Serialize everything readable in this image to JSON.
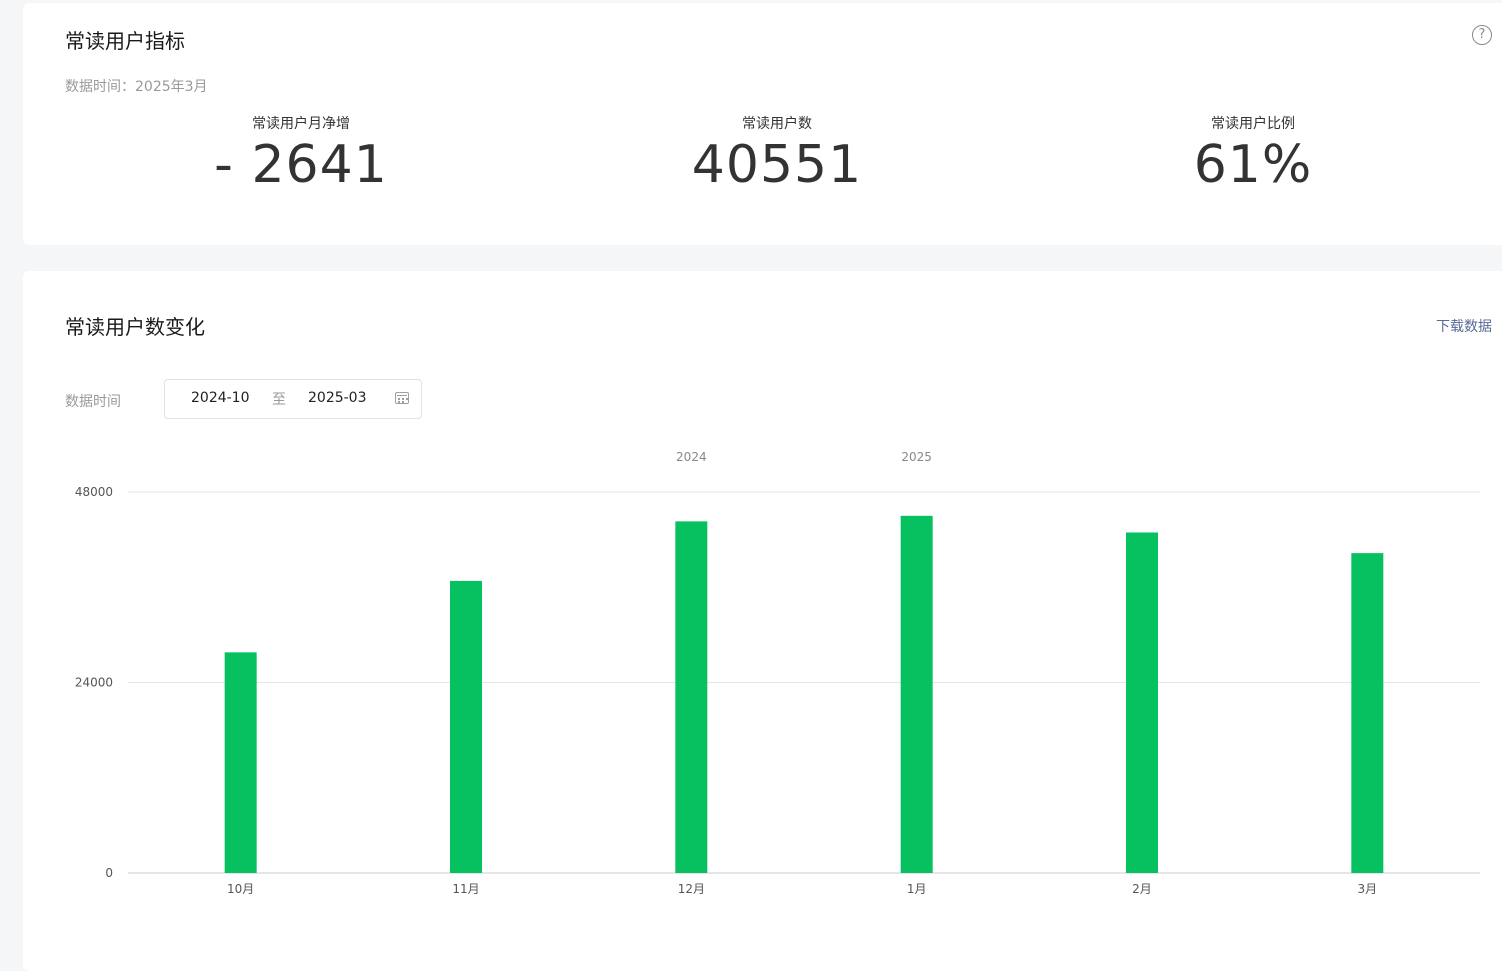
{
  "metrics_card": {
    "title": "常读用户指标",
    "help_icon": "question-circle-icon",
    "data_time": "数据时间：2025年3月",
    "metrics": [
      {
        "label": "常读用户月净增",
        "value": "- 2641"
      },
      {
        "label": "常读用户数",
        "value": "40551"
      },
      {
        "label": "常读用户比例",
        "value": "61%"
      }
    ]
  },
  "trend_card": {
    "title": "常读用户数变化",
    "download_label": "下载数据",
    "range_label": "数据时间",
    "range_start": "2024-10",
    "range_sep": "至",
    "range_end": "2025-03",
    "calendar_icon": "calendar-icon"
  },
  "colors": {
    "bar": "#07c160",
    "grid": "#e6e6e6",
    "link": "#576b95"
  },
  "chart_data": {
    "type": "bar",
    "categories": [
      "10月",
      "11月",
      "12月",
      "1月",
      "2月",
      "3月"
    ],
    "values": [
      27800,
      36800,
      44300,
      45000,
      42900,
      40300
    ],
    "year_labels": [
      {
        "label": "2024",
        "category_index": 2
      },
      {
        "label": "2025",
        "category_index": 3
      }
    ],
    "yticks": [
      0,
      24000,
      48000
    ],
    "ylim": [
      0,
      48000
    ],
    "grid": true
  }
}
